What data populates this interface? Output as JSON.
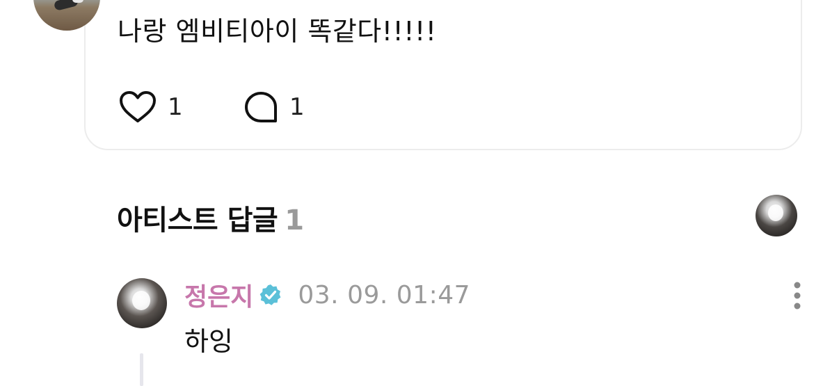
{
  "post": {
    "text": "나랑 엠비티아이 똑같다!!!!!",
    "like_count": "1",
    "reply_count": "1"
  },
  "artist_replies": {
    "title": "아티스트 답글",
    "count": "1"
  },
  "comment": {
    "author": "정은지",
    "timestamp": "03. 09. 01:47",
    "text": "하잉"
  },
  "colors": {
    "author_name": "#c777ab",
    "verified_badge": "#5bc0d8",
    "muted": "#9a9a9a"
  },
  "icons": {
    "like": "heart-icon",
    "reply": "speech-bubble-icon",
    "verified": "verified-badge-icon",
    "more": "more-vertical-icon"
  }
}
